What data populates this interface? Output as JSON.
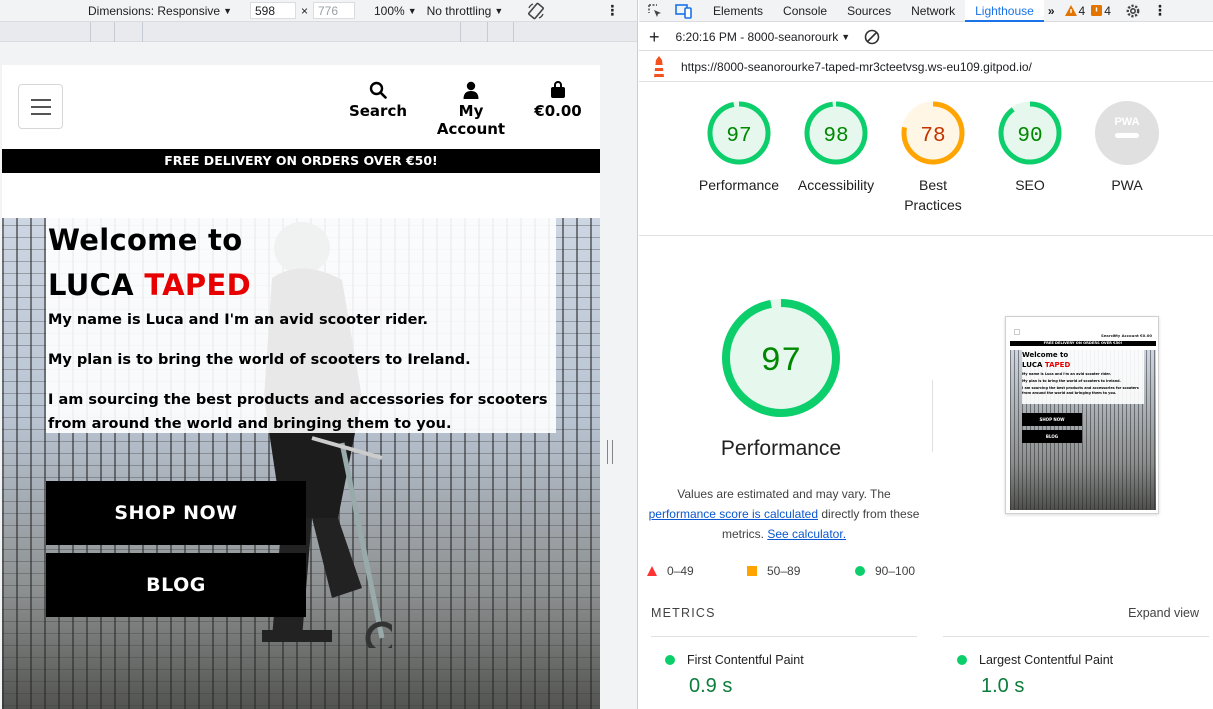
{
  "device_toolbar": {
    "dimensions_label": "Dimensions: Responsive",
    "width": "598",
    "height": "776",
    "zoom": "100%",
    "throttling": "No throttling"
  },
  "site": {
    "nav": {
      "search": "Search",
      "account": "My Account",
      "cart": "€0.00"
    },
    "delivery_banner": "FREE DELIVERY ON ORDERS OVER €50!",
    "hero": {
      "title_line1": "Welcome to",
      "title_luca": "LUCA",
      "title_taped": "TAPED",
      "p1": "My name is Luca and I'm an avid scooter rider.",
      "p2": "My plan is to bring the world of scooters to Ireland.",
      "p3": "I am sourcing the best products and accessories for scooters from around the world and bringing them to you.",
      "shop_button": "SHOP NOW",
      "blog_button": "BLOG"
    },
    "colors": {
      "brand_red": "#e60000",
      "black": "#000000"
    }
  },
  "devtools": {
    "tabs": [
      "Elements",
      "Console",
      "Sources",
      "Network",
      "Lighthouse"
    ],
    "active_tab": "Lighthouse",
    "more_tabs": "»",
    "warnings_count": "4",
    "issues_count": "4",
    "report_selector": "6:20:16 PM - 8000-seanorourk",
    "url": "https://8000-seanorourke7-taped-mr3cteetvsg.ws-eu109.gitpod.io/",
    "scores": [
      {
        "label": "Performance",
        "value": 97,
        "status": "pass"
      },
      {
        "label": "Accessibility",
        "value": 98,
        "status": "pass"
      },
      {
        "label": "Best Practices",
        "value": 78,
        "status": "average"
      },
      {
        "label": "SEO",
        "value": 90,
        "status": "pass"
      },
      {
        "label": "PWA",
        "value": null,
        "status": "na",
        "badge": "PWA"
      }
    ],
    "performance": {
      "score": 97,
      "title": "Performance",
      "note_part1": "Values are estimated and may vary. The",
      "note_link1": "performance score is calculated",
      "note_part2": "directly from these metrics.",
      "note_link2": "See calculator."
    },
    "legend": [
      {
        "range": "0–49",
        "shape": "triangle",
        "color": "#ff3333"
      },
      {
        "range": "50–89",
        "shape": "square",
        "color": "#ffa400"
      },
      {
        "range": "90–100",
        "shape": "circle",
        "color": "#0cce6b"
      }
    ],
    "metrics_title": "METRICS",
    "expand_view": "Expand view",
    "metrics": [
      {
        "name": "First Contentful Paint",
        "value": "0.9 s"
      },
      {
        "name": "Largest Contentful Paint",
        "value": "1.0 s"
      }
    ],
    "thumbnail": {
      "banner": "FREE DELIVERY ON ORDERS OVER €50!",
      "title_line1": "Welcome to",
      "title_luca": "LUCA",
      "title_taped": "TAPED",
      "p1": "My name is Luca and I'm an avid scooter rider.",
      "p2": "My plan is to bring the world of scooters to Ireland.",
      "p3": "I am sourcing the best products and accessories for scooters from around the world and bringing them to you.",
      "shop_button": "SHOP NOW",
      "blog_button": "BLOG",
      "nav_search": "Search",
      "nav_account": "My Account",
      "nav_cart": "€0.00"
    },
    "colors": {
      "pass": "#0cce6b",
      "pass_text": "#008800",
      "average": "#ffa400",
      "average_text": "#c33300",
      "na": "#e0e0e0",
      "link": "#0b57d0"
    }
  }
}
